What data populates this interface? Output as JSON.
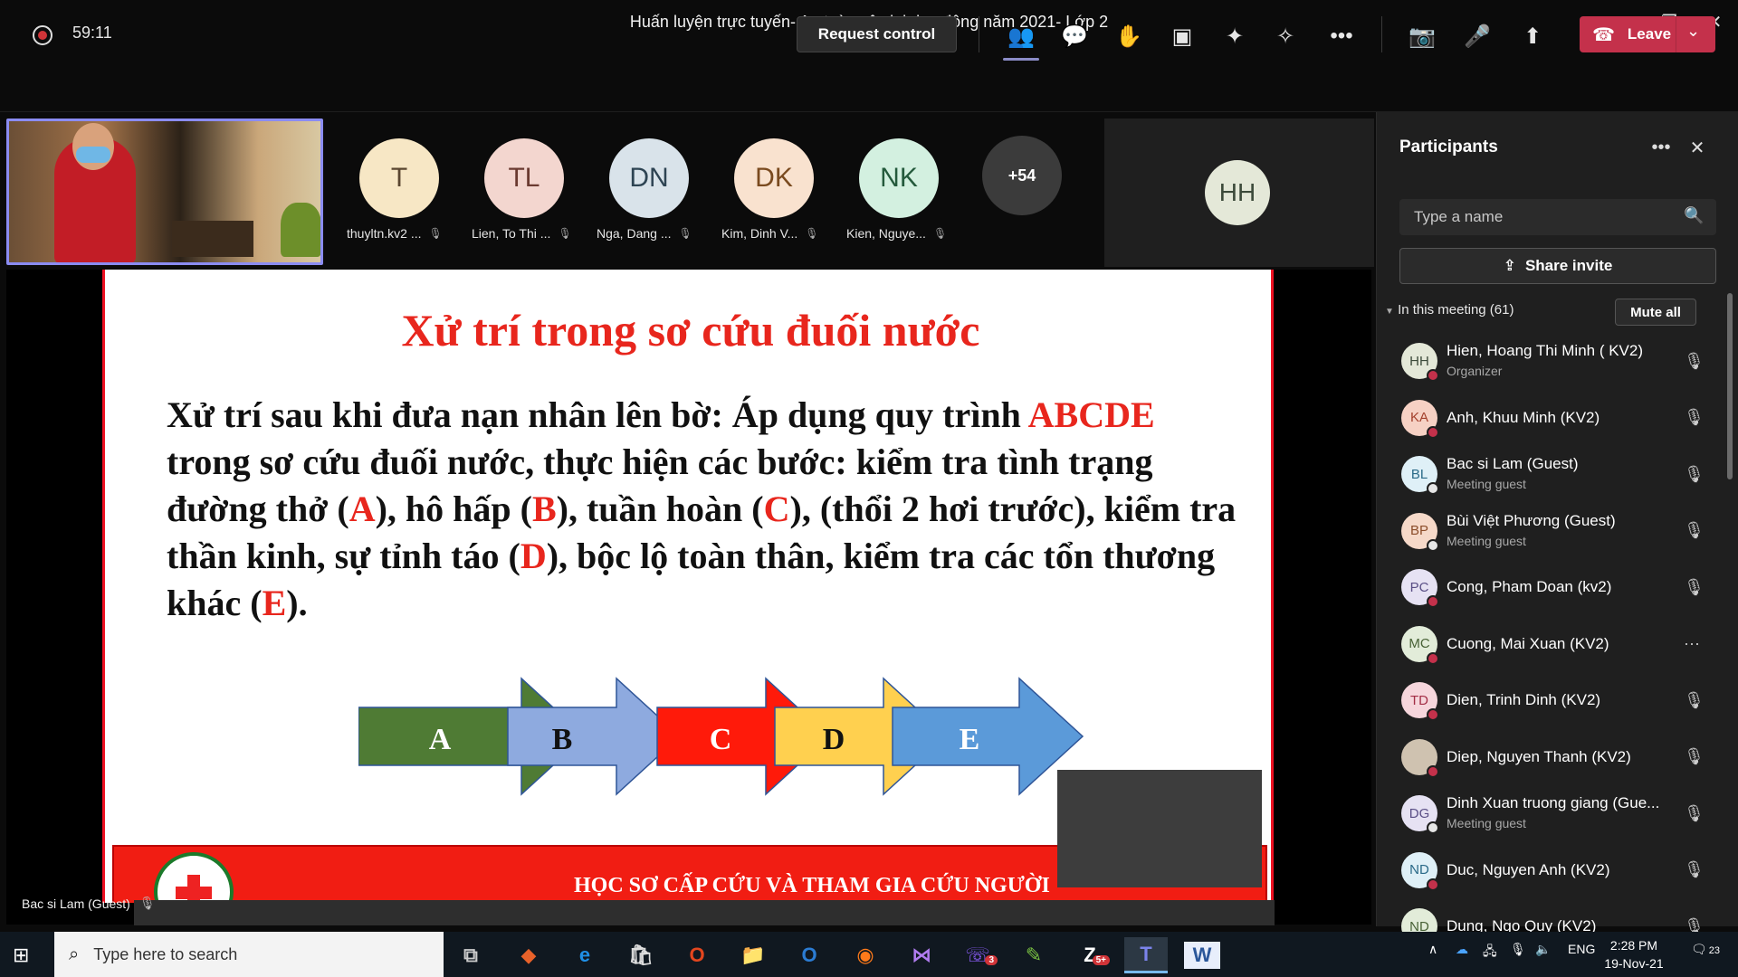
{
  "window": {
    "title": "Huấn luyện trực tuyến- An toàn vệ sinh lao động năm 2021- Lớp 2"
  },
  "toolbar": {
    "timer": "59:11",
    "request_control": "Request control",
    "leave": "Leave"
  },
  "strip": {
    "participants": [
      {
        "initials": "T",
        "name": "thuyltn.kv2 ...",
        "bg": "#f7e7c5",
        "fg": "#5a4630"
      },
      {
        "initials": "TL",
        "name": "Lien, To Thi ...",
        "bg": "#f3d6cf",
        "fg": "#6a3a30"
      },
      {
        "initials": "DN",
        "name": "Nga, Dang ...",
        "bg": "#d9e3ea",
        "fg": "#2e4453"
      },
      {
        "initials": "DK",
        "name": "Kim, Dinh V...",
        "bg": "#f9e2cf",
        "fg": "#7a4a1f"
      },
      {
        "initials": "NK",
        "name": "Kien, Nguye...",
        "bg": "#d3f0e0",
        "fg": "#245a3c"
      }
    ],
    "more_count": "+54",
    "hh_initials": "HH"
  },
  "slide": {
    "title": "Xử trí trong sơ cứu đuối nước",
    "body_parts": {
      "p1": "Xử trí sau khi đưa nạn nhân lên bờ: Áp dụng quy trình ",
      "abcde": "ABCDE",
      "p2": " trong sơ cứu đuối nước, thực hiện các bước: kiểm tra tình trạng đường thở (",
      "a": "A",
      "p3": "), hô hấp (",
      "b": "B",
      "p4": "), tuần hoàn (",
      "c": "C",
      "p5": "), (thổi 2 hơi trước), kiểm tra thần kinh, sự tỉnh táo (",
      "d": "D",
      "p6": "), bộc lộ toàn thân, kiểm tra các tổn thương khác (",
      "e": "E",
      "p7": ")."
    },
    "arrows": [
      {
        "label": "A",
        "color": "#4f7b34"
      },
      {
        "label": "B",
        "color": "#8eaadf"
      },
      {
        "label": "C",
        "color": "#ff1a0a"
      },
      {
        "label": "D",
        "color": "#ffd04f"
      },
      {
        "label": "E",
        "color": "#5b9ad9"
      }
    ],
    "ribbon_text": "HỌC SƠ CẤP CỨU VÀ THAM GIA CỨU NGƯỜI"
  },
  "speaker_label": "Bac si Lam (Guest)",
  "panel": {
    "title": "Participants",
    "search_placeholder": "Type a name",
    "share_invite": "Share invite",
    "in_meeting": "In this meeting (61)",
    "mute_all": "Mute all",
    "list": [
      {
        "initials": "HH",
        "name": "Hien, Hoang Thi Minh ( KV2)",
        "sub": "Organizer",
        "bg": "#e4e8d8",
        "fg": "#3c4a3a",
        "status": "#c4314b",
        "action": "mic-off"
      },
      {
        "initials": "KA",
        "name": "Anh, Khuu Minh (KV2)",
        "sub": "",
        "bg": "#f6d1c4",
        "fg": "#a3402c",
        "status": "#c4314b",
        "action": "mic-off"
      },
      {
        "initials": "BL",
        "name": "Bac si Lam (Guest)",
        "sub": "Meeting guest",
        "bg": "#dff0f7",
        "fg": "#2a6a88",
        "status": "#e6e6e6",
        "action": "mic-off"
      },
      {
        "initials": "BP",
        "name": "Bùi Việt Phương (Guest)",
        "sub": "Meeting guest",
        "bg": "#f6d9c9",
        "fg": "#8b4d2a",
        "status": "#e6e6e6",
        "action": "mic-off"
      },
      {
        "initials": "PC",
        "name": "Cong, Pham Doan (kv2)",
        "sub": "",
        "bg": "#e6e2f3",
        "fg": "#5a4f86",
        "status": "#c4314b",
        "action": "mic-off"
      },
      {
        "initials": "MC",
        "name": "Cuong, Mai Xuan (KV2)",
        "sub": "",
        "bg": "#e2ecd9",
        "fg": "#486236",
        "status": "#c4314b",
        "action": "more"
      },
      {
        "initials": "TD",
        "name": "Dien, Trinh Dinh (KV2)",
        "sub": "",
        "bg": "#f6d6dc",
        "fg": "#a32e46",
        "status": "#c4314b",
        "action": "mic-off"
      },
      {
        "initials": "",
        "name": "Diep, Nguyen Thanh (KV2)",
        "sub": "",
        "bg": "#cfc2b0",
        "fg": "#333",
        "status": "#c4314b",
        "action": "mic-off"
      },
      {
        "initials": "DG",
        "name": "Dinh Xuan truong giang (Gue...",
        "sub": "Meeting guest",
        "bg": "#e6e2f3",
        "fg": "#5a4f86",
        "status": "#e6e6e6",
        "action": "mic-off"
      },
      {
        "initials": "ND",
        "name": "Duc, Nguyen Anh (KV2)",
        "sub": "",
        "bg": "#dff0f7",
        "fg": "#2a6a88",
        "status": "#c4314b",
        "action": "mic-off"
      },
      {
        "initials": "ND",
        "name": "Dung, Ngo Quy (KV2)",
        "sub": "",
        "bg": "#e2ecd9",
        "fg": "#486236",
        "status": "#c4314b",
        "action": "mic-off"
      }
    ]
  },
  "taskbar": {
    "search_placeholder": "Type here to search",
    "lang": "ENG",
    "time": "2:28 PM",
    "date": "19-Nov-21",
    "notifications": "23",
    "viber_badge": "3",
    "zalo_badge": "5+"
  }
}
